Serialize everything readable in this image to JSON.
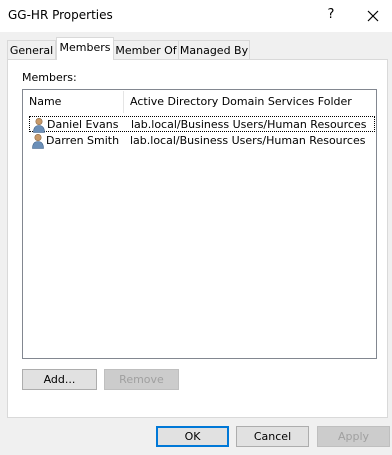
{
  "window": {
    "title": "GG-HR Properties",
    "help_glyph": "?"
  },
  "tabs": [
    {
      "label": "General"
    },
    {
      "label": "Members"
    },
    {
      "label": "Member Of"
    },
    {
      "label": "Managed By"
    }
  ],
  "members": {
    "label": "Members:",
    "columns": [
      "Name",
      "Active Directory Domain Services Folder"
    ],
    "rows": [
      {
        "name": "Daniel Evans",
        "folder": "lab.local/Business Users/Human Resources"
      },
      {
        "name": "Darren Smith",
        "folder": "lab.local/Business Users/Human Resources"
      }
    ],
    "add_label": "Add...",
    "remove_label": "Remove"
  },
  "footer": {
    "ok_label": "OK",
    "cancel_label": "Cancel",
    "apply_label": "Apply"
  }
}
